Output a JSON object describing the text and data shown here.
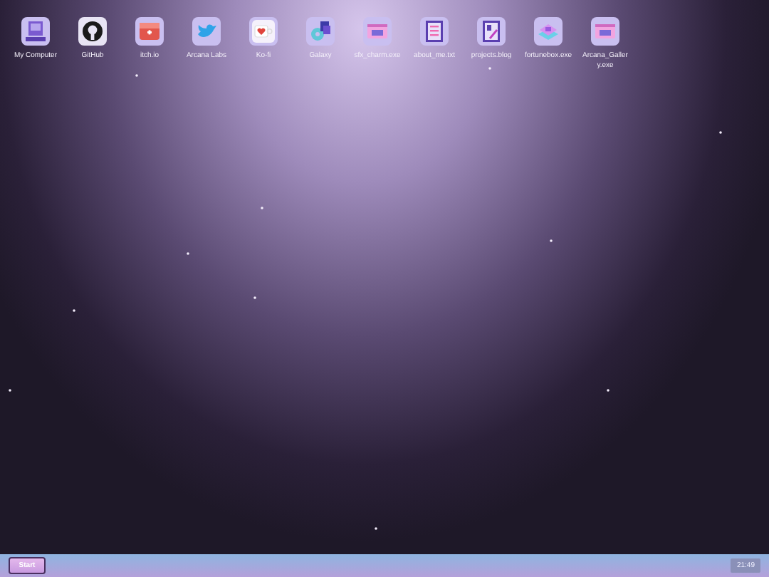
{
  "desktop_icons": [
    {
      "label": "My Computer",
      "kind": "computer"
    },
    {
      "label": "GitHub",
      "kind": "github"
    },
    {
      "label": "itch.io",
      "kind": "store"
    },
    {
      "label": "Arcana Labs",
      "kind": "bird"
    },
    {
      "label": "Ko-fi",
      "kind": "cup"
    },
    {
      "label": "Galaxy",
      "kind": "galaxy"
    },
    {
      "label": "sfx_charm.exe",
      "kind": "window"
    },
    {
      "label": "about_me.txt",
      "kind": "document"
    },
    {
      "label": "projects.blog",
      "kind": "notebook"
    },
    {
      "label": "fortunebox.exe",
      "kind": "box"
    },
    {
      "label": "Arcana_Gallery.exe",
      "kind": "window"
    }
  ],
  "taskbar": {
    "start_button": "Start",
    "clock": "21:49"
  }
}
